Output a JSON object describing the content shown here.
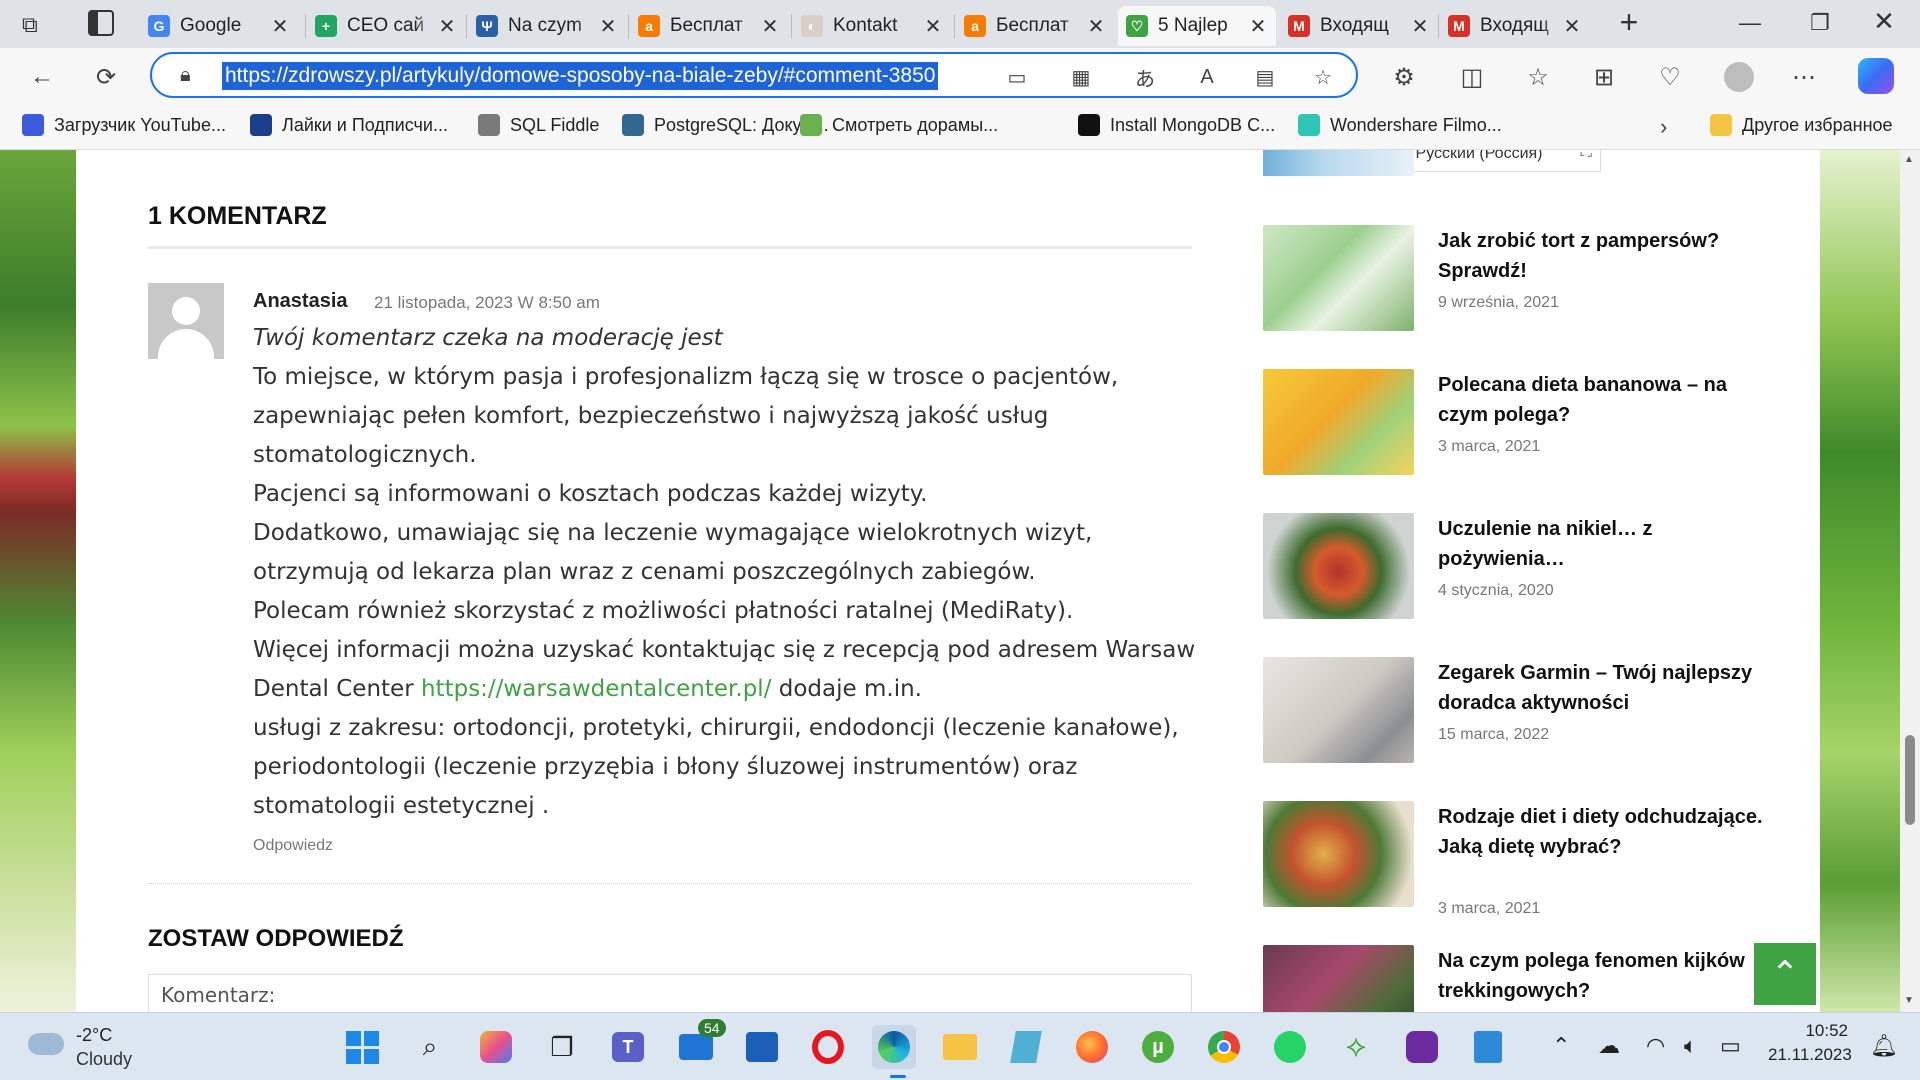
{
  "browser": {
    "tabs": [
      {
        "title": "Google",
        "fav": "G",
        "favcolor": "#4285f4",
        "active": false
      },
      {
        "title": "CEO сай",
        "fav": "+",
        "favcolor": "#21a464",
        "active": false
      },
      {
        "title": "Na czym",
        "fav": "Ψ",
        "favcolor": "#2b5fa8",
        "active": false
      },
      {
        "title": "Бесплат",
        "fav": "a",
        "favcolor": "#f57c00",
        "active": false
      },
      {
        "title": "Kontakt",
        "fav": "◐",
        "favcolor": "#d8cfc6",
        "active": false
      },
      {
        "title": "Бесплат",
        "fav": "a",
        "favcolor": "#f57c00",
        "active": false
      },
      {
        "title": "5 Najlep",
        "fav": "♡",
        "favcolor": "#3fa343",
        "active": true
      },
      {
        "title": "Входящ",
        "fav": "M",
        "favcolor": "#d93025",
        "active": false
      },
      {
        "title": "Входящ",
        "fav": "M",
        "favcolor": "#d93025",
        "active": false
      }
    ],
    "url": "https://zdrowszy.pl/artykuly/domowe-sposoby-na-biale-zeby/#comment-3850",
    "bookmarks": [
      {
        "label": "Загрузчик YouTube...",
        "icon": "youtube-downloader-icon",
        "color": "#3b5bdb"
      },
      {
        "label": "Лайки и Подписчи...",
        "icon": "heart-icon",
        "color": "#1c3d8c"
      },
      {
        "label": "SQL Fiddle",
        "icon": "sql-fiddle-icon",
        "color": "#7a7a7a"
      },
      {
        "label": "PostgreSQL: Докум...",
        "icon": "postgresql-icon",
        "color": "#336791"
      },
      {
        "label": "Смотреть дорамы...",
        "icon": "dorama-icon",
        "color": "#6ab04c"
      },
      {
        "label": "Install MongoDB C...",
        "icon": "mongodb-icon",
        "color": "#111"
      },
      {
        "label": "Wondershare Filmo...",
        "icon": "filmora-icon",
        "color": "#2ec4b6"
      }
    ],
    "other_bookmarks": "Другое избранное"
  },
  "page": {
    "lang_popup": "RU Русский (Россия)",
    "comments_heading": "1 KOMENTARZ",
    "comment": {
      "author": "Anastasia",
      "date": "21 listopada, 2023 W 8:50 am",
      "moderation": "Twój komentarz czeka na moderację jest",
      "lines": [
        "To miejsce, w którym pasja i profesjonalizm łączą się w trosce o pacjentów,",
        "zapewniając pełen komfort, bezpieczeństwo i najwyższą jakość usług",
        "stomatologicznych.",
        "Pacjenci są informowani o kosztach podczas każdej wizyty.",
        "Dodatkowo, umawiając się na leczenie wymagające wielokrotnych wizyt,",
        "otrzymują od lekarza plan wraz z cenami poszczególnych zabiegów.",
        "Polecam również skorzystać z możliwości płatności ratalnej (MediRaty).",
        "Więcej informacji można uzyskać kontaktując się z recepcją pod adresem Warsaw"
      ],
      "line_link_prefix": "Dental Center ",
      "link": "https://warsawdentalcenter.pl/",
      "line_link_suffix": " dodaje m.in.",
      "lines_after": [
        "usługi z zakresu: ortodoncji, protetyki, chirurgii, endodoncji (leczenie kanałowe),",
        "periodontologii (leczenie przyzębia i błony śluzowej instrumentów) oraz",
        "stomatologii estetycznej ."
      ],
      "reply": "Odpowiedz"
    },
    "reply_heading": "ZOSTAW ODPOWIEDŹ",
    "comment_placeholder": "Komentarz:",
    "sidebar_posts": [
      {
        "title": "Jak zrobić tort z pampersów? Sprawdź!",
        "date": "9 września, 2021",
        "img": "towel-rolls-image"
      },
      {
        "title": "Polecana dieta bananowa – na czym polega?",
        "date": "3 marca, 2021",
        "img": "bananas-image"
      },
      {
        "title": "Uczulenie na nikiel… z pożywienia…",
        "date": "4 stycznia, 2020",
        "img": "salad-bowl-image"
      },
      {
        "title": "Zegarek Garmin – Twój najlepszy doradca aktywności",
        "date": "15 marca, 2022",
        "img": "yoga-woman-image"
      },
      {
        "title": "Rodzaje diet i diety odchudzające. Jaką dietę wybrać?",
        "date": "3 marca, 2021",
        "img": "healthy-food-image"
      },
      {
        "title": "Na czym polega fenomen kijków trekkingowych?",
        "date": "",
        "img": "trekking-poles-image"
      }
    ]
  },
  "taskbar": {
    "weather_temp": "-2°C",
    "weather_desc": "Cloudy",
    "mail_badge": "54",
    "time": "10:52",
    "date": "21.11.2023"
  }
}
